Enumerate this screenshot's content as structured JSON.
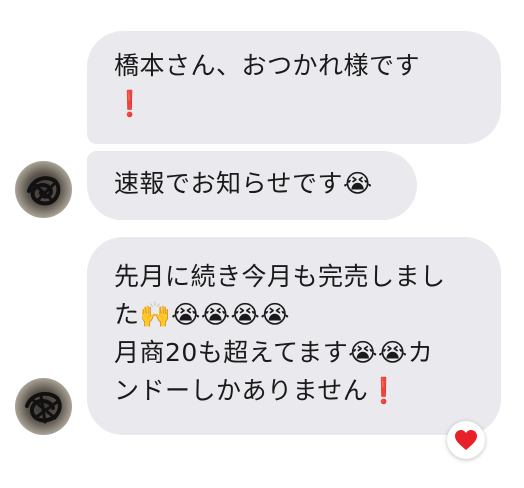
{
  "messages": [
    {
      "lines": [
        "橋本さん、おつかれ様です",
        "❗"
      ]
    },
    {
      "lines": [
        "速報でお知らせです😭"
      ]
    },
    {
      "lines": [
        "先月に続き今月も完売しまし",
        "た🙌😭😭😭😭",
        "月商20も超えてます😭😭カ",
        "ンドーしかありません❗"
      ]
    }
  ],
  "reaction": {
    "icon": "heart-icon",
    "color": "#e8202a"
  },
  "colors": {
    "bubble": "#e9e9ee",
    "text": "#1a1a1a"
  }
}
